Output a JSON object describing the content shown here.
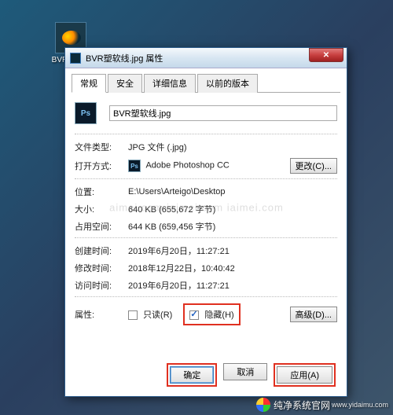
{
  "desktop": {
    "icon_label": "BVR塑软线.jpg"
  },
  "dialog": {
    "title": "BVR塑软线.jpg 属性",
    "tabs": [
      "常规",
      "安全",
      "详细信息",
      "以前的版本"
    ],
    "filename": "BVR塑软线.jpg",
    "fields": {
      "filetype_label": "文件类型:",
      "filetype_value": "JPG 文件 (.jpg)",
      "openwith_label": "打开方式:",
      "openwith_value": "Adobe Photoshop CC",
      "change_btn": "更改(C)...",
      "location_label": "位置:",
      "location_value": "E:\\Users\\Arteigo\\Desktop",
      "size_label": "大小:",
      "size_value": "640 KB (655,672 字节)",
      "sizeondisk_label": "占用空间:",
      "sizeondisk_value": "644 KB (659,456 字节)",
      "created_label": "创建时间:",
      "created_value": "2019年6月20日，11:27:21",
      "modified_label": "修改时间:",
      "modified_value": "2018年12月22日，10:40:42",
      "accessed_label": "访问时间:",
      "accessed_value": "2019年6月20日，11:27:21",
      "attributes_label": "属性:",
      "readonly_label": "只读(R)",
      "hidden_label": "隐藏(H)",
      "advanced_btn": "高级(D)..."
    },
    "buttons": {
      "ok": "确定",
      "cancel": "取消",
      "apply": "应用(A)"
    }
  },
  "watermark": "aimei.com  iaimei.com  iaimei.com",
  "brand": {
    "name": "纯净系统官网",
    "url": "www.yidaimu.com"
  }
}
